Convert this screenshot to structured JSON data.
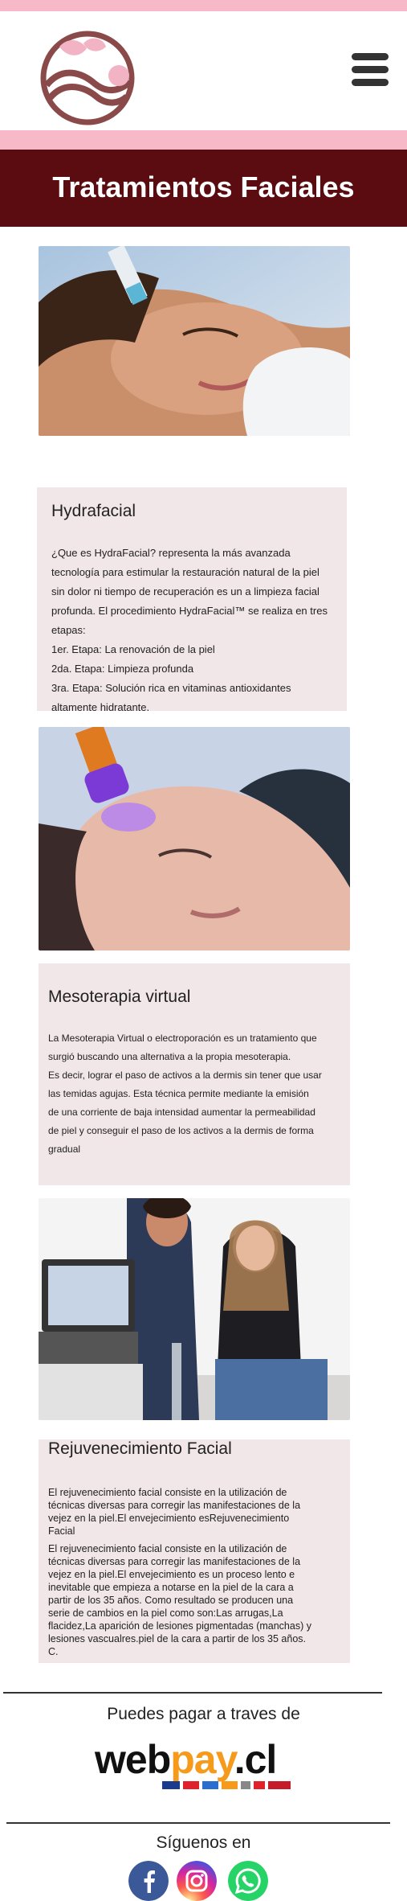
{
  "header": {
    "logo": "logo-icon",
    "menu": "menu-icon"
  },
  "banner": {
    "title": "Tratamientos Faciales"
  },
  "hydrafacial": {
    "title": "Hydrafacial",
    "lines": [
      "¿Que es HydraFacial? representa la más avanzada",
      "tecnología para estimular la restauración natural de la piel",
      "sin dolor ni tiempo de recuperación es un a limpieza facial",
      "profunda. El procedimiento HydraFacial™ se realiza en tres",
      "etapas:",
      "1er. Etapa: La renovación de la piel",
      "2da. Etapa: Limpieza profunda",
      "3ra. Etapa: Solución rica en vitaminas antioxidantes",
      "altamente hidratante."
    ]
  },
  "mesoterapia": {
    "title": "Mesoterapia virtual",
    "lines": [
      "La Mesoterapia Virtual o electroporación es un tratamiento que",
      " surgió buscando una alternativa a la propia mesoterapia.",
      "Es decir, lograr el paso de activos a la dermis sin tener que usar",
      "las temidas agujas. Esta técnica permite mediante la emisión",
      " de una corriente de baja intensidad aumentar la permeabilidad",
      " de piel y conseguir el paso de los activos a la dermis de forma",
      "gradual"
    ]
  },
  "rejuvenecimiento": {
    "title": "Rejuvenecimiento Facial",
    "para1": [
      " El rejuvenecimiento facial consiste en la utilización de",
      "técnicas diversas para corregir las manifestaciones de la",
      "vejez en la piel.El envejecimiento esRejuvenecimiento",
      "Facial"
    ],
    "para2": [
      " El rejuvenecimiento facial consiste en la utilización de",
      "técnicas diversas para corregir las manifestaciones de la",
      "vejez en la piel.El envejecimiento es un proceso lento e",
      "inevitable que empieza a notarse en la piel de la cara a",
      "partir de los 35 años. Como resultado se producen una",
      "serie de cambios en la piel como son:Las arrugas,La",
      "flacidez,La aparición de lesiones pigmentadas (manchas) y",
      "lesiones vascualres.piel de la cara a partir de los 35 años.",
      "C."
    ]
  },
  "payment": {
    "text": "Puedes pagar a traves de",
    "logo_text_a": "web",
    "logo_text_b": "pay",
    "logo_text_c": ".cl",
    "colors": {
      "black": "#111111",
      "orange": "#f59a1a",
      "red": "#e0202a"
    }
  },
  "social": {
    "title": "Síguenos en",
    "icons": [
      "facebook-icon",
      "instagram-icon",
      "whatsapp-icon"
    ],
    "colors": {
      "facebook": "#3b5998",
      "instagram": "#d6249f",
      "whatsapp": "#25d366"
    }
  },
  "colors": {
    "pink": "#f7b8c7",
    "maroon": "#5a0c10",
    "card": "#f1e6e8",
    "logo": "#8b4a4a"
  }
}
